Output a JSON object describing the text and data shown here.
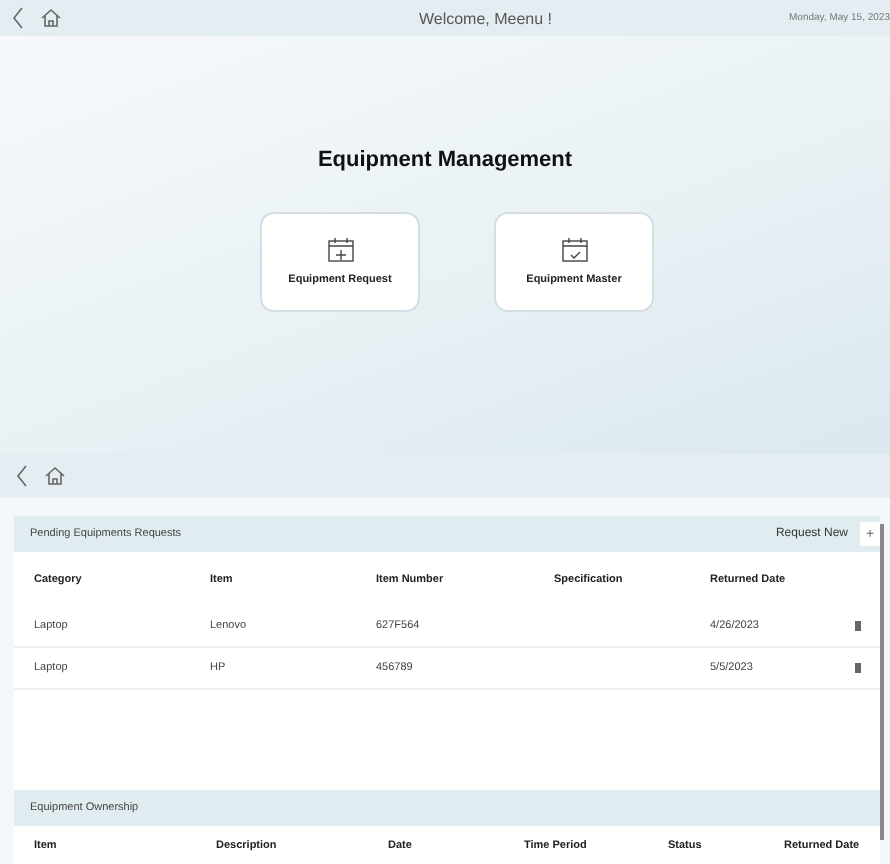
{
  "header": {
    "title": "Welcome, Meenu !",
    "date": "Monday, May 15, 2023"
  },
  "main": {
    "title": "Equipment Management",
    "tiles": [
      {
        "label": "Equipment Request",
        "kind": "add"
      },
      {
        "label": "Equipment Master",
        "kind": "check"
      }
    ]
  },
  "pending": {
    "title": "Pending Equipments Requests",
    "action": "Request New",
    "action_icon": "+",
    "columns": [
      "Category",
      "Item",
      "Item Number",
      "Specification",
      "Returned Date"
    ],
    "rows": [
      [
        "Laptop",
        "Lenovo",
        "627F564",
        "",
        "4/26/2023"
      ],
      [
        "Laptop",
        "HP",
        "456789",
        "",
        "5/5/2023"
      ]
    ]
  },
  "ownership": {
    "title": "Equipment Ownership",
    "columns": [
      "Item",
      "Description",
      "Date",
      "Time Period",
      "Status",
      "Returned Date"
    ]
  }
}
